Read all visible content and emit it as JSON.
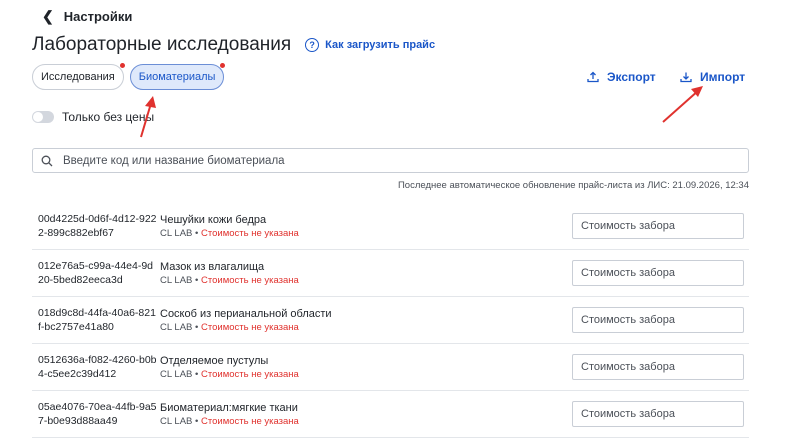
{
  "header": {
    "back_label": "Настройки",
    "title": "Лабораторные исследования",
    "help_link": "Как загрузить прайс",
    "help_icon_glyph": "?"
  },
  "tabs": [
    {
      "label": "Исследования",
      "active": false,
      "has_dot": true
    },
    {
      "label": "Биоматериалы",
      "active": true,
      "has_dot": true
    }
  ],
  "actions": {
    "export_label": "Экспорт",
    "import_label": "Импорт"
  },
  "filter": {
    "toggle_label": "Только без цены",
    "toggle_on": false
  },
  "search": {
    "placeholder": "Введите код или название биоматериала",
    "value": ""
  },
  "update_note": "Последнее автоматическое обновление прайс-листа из ЛИС: 21.09.2026, 12:34",
  "rows": [
    {
      "code": "00d4225d-0d6f-4d12-9222-899c882ebf67",
      "name": "Чешуйки кожи бедра",
      "lab": "CL LAB",
      "sep": "•",
      "status": "Стоимость не указана",
      "fee_placeholder": "Стоимость забора"
    },
    {
      "code": "012e76a5-c99a-44e4-9d20-5bed82eeca3d",
      "name": "Мазок из влагалища",
      "lab": "CL LAB",
      "sep": "•",
      "status": "Стоимость не указана",
      "fee_placeholder": "Стоимость забора"
    },
    {
      "code": "018d9c8d-44fa-40a6-821f-bc2757e41a80",
      "name": "Соскоб из перианальной области",
      "lab": "CL LAB",
      "sep": "•",
      "status": "Стоимость не указана",
      "fee_placeholder": "Стоимость забора"
    },
    {
      "code": "0512636a-f082-4260-b0b4-c5ee2c39d412",
      "name": "Отделяемое пустулы",
      "lab": "CL LAB",
      "sep": "•",
      "status": "Стоимость не указана",
      "fee_placeholder": "Стоимость забора"
    },
    {
      "code": "05ae4076-70ea-44fb-9a57-b0e93d88aa49",
      "name": "Биоматериал:мягкие ткани",
      "lab": "CL LAB",
      "sep": "•",
      "status": "Стоимость не указана",
      "fee_placeholder": "Стоимость забора"
    }
  ],
  "colors": {
    "accent": "#1a56c8",
    "warning": "#e0322e",
    "annotation_arrow": "#e0322e"
  }
}
